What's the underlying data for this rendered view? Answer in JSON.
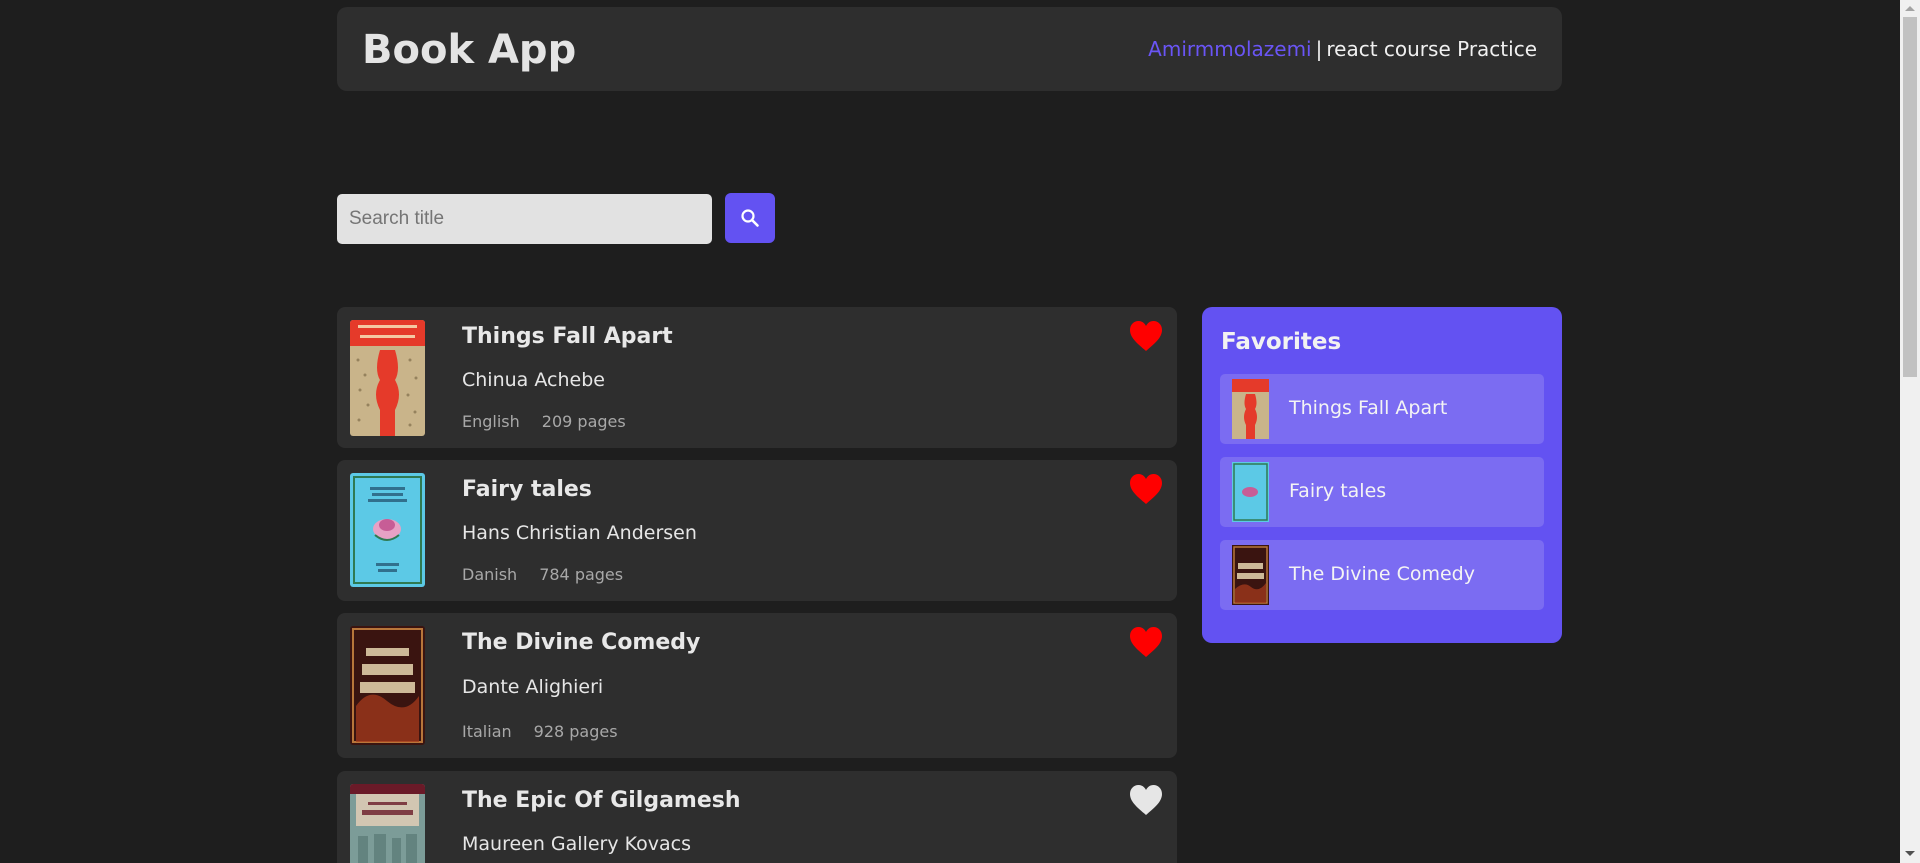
{
  "header": {
    "title": "Book App",
    "author_link": "Amirmmolazemi",
    "separator": "|",
    "subtitle": "react course Practice"
  },
  "search": {
    "placeholder": "Search title",
    "value": "",
    "button_icon": "search-icon"
  },
  "books": [
    {
      "title": "Things Fall Apart",
      "author": "Chinua Achebe",
      "language": "English",
      "pages": "209 pages",
      "favorite": true,
      "cover_text": "Chinua Achebe THINGS FALL APART"
    },
    {
      "title": "Fairy tales",
      "author": "Hans Christian Andersen",
      "language": "Danish",
      "pages": "784 pages",
      "favorite": true,
      "cover_text": "HANS CHRISTIAN ANDERSEN"
    },
    {
      "title": "The Divine Comedy",
      "author": "Dante Alighieri",
      "language": "Italian",
      "pages": "928 pages",
      "favorite": true,
      "cover_text": "THE DIVINE COMEDY"
    },
    {
      "title": "The Epic Of Gilgamesh",
      "author": "Maureen Gallery Kovacs",
      "language": "",
      "pages": "",
      "favorite": false,
      "cover_text": "The Epic of GILGAMESH"
    }
  ],
  "favorites": {
    "heading": "Favorites",
    "items": [
      {
        "label": "Things Fall Apart"
      },
      {
        "label": "Fairy tales"
      },
      {
        "label": "The Divine Comedy"
      }
    ]
  },
  "colors": {
    "background": "#1e1e1e",
    "card": "#2e2e2e",
    "accent": "#6352f2",
    "favorite_item": "#7b6cf2",
    "heart_active": "#ff0000",
    "heart_inactive": "#e6e6e6"
  }
}
